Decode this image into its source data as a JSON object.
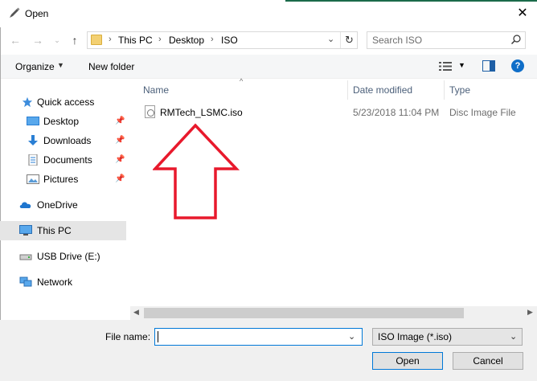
{
  "window": {
    "title": "Open"
  },
  "address": {
    "crumbs": [
      "This PC",
      "Desktop",
      "ISO"
    ],
    "search_placeholder": "Search ISO"
  },
  "toolbar": {
    "organize": "Organize",
    "new_folder": "New folder"
  },
  "nav": {
    "items": [
      {
        "label": "Quick access"
      },
      {
        "label": "Desktop"
      },
      {
        "label": "Downloads"
      },
      {
        "label": "Documents"
      },
      {
        "label": "Pictures"
      },
      {
        "label": "OneDrive"
      },
      {
        "label": "This PC"
      },
      {
        "label": "USB Drive (E:)"
      },
      {
        "label": "Network"
      }
    ]
  },
  "columns": {
    "name": "Name",
    "date": "Date modified",
    "type": "Type"
  },
  "files": [
    {
      "name": "RMTech_LSMC.iso",
      "date": "5/23/2018 11:04 PM",
      "type": "Disc Image File"
    }
  ],
  "footer": {
    "filename_label": "File name:",
    "filename_value": "",
    "filetype": "ISO Image (*.iso)",
    "open": "Open",
    "cancel": "Cancel"
  },
  "colors": {
    "accent": "#0078d7",
    "annotation_arrow": "#e8192c"
  }
}
